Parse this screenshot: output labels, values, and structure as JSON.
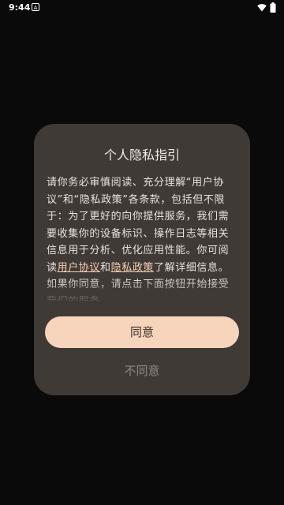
{
  "status_bar": {
    "time": "9:44",
    "notification_glyph": "A",
    "icons": [
      "wifi-icon",
      "battery-icon"
    ]
  },
  "dialog": {
    "title": "个人隐私指引",
    "body_before": "请你务必审慎阅读、充分理解“用户协议”和“隐私政策”各条款，包括但不限于：为了更好的向你提供服务，我们需要收集你的设备标识、操作日志等相关信息用于分析、优化应用性能。你可阅读",
    "link_user_agreement": "用户协议",
    "connector": "和",
    "link_privacy_policy": "隐私政策",
    "body_after": "了解详细信息。如果你同意，请点击下面按钮开始接受我们的服务。",
    "agree_label": "同意",
    "disagree_label": "不同意"
  },
  "colors": {
    "background": "#0a0a0a",
    "dialog_bg": "#403a37",
    "accent_button": "#f6d5bc",
    "link": "#f8d0b5",
    "muted_text": "#8e8782"
  }
}
